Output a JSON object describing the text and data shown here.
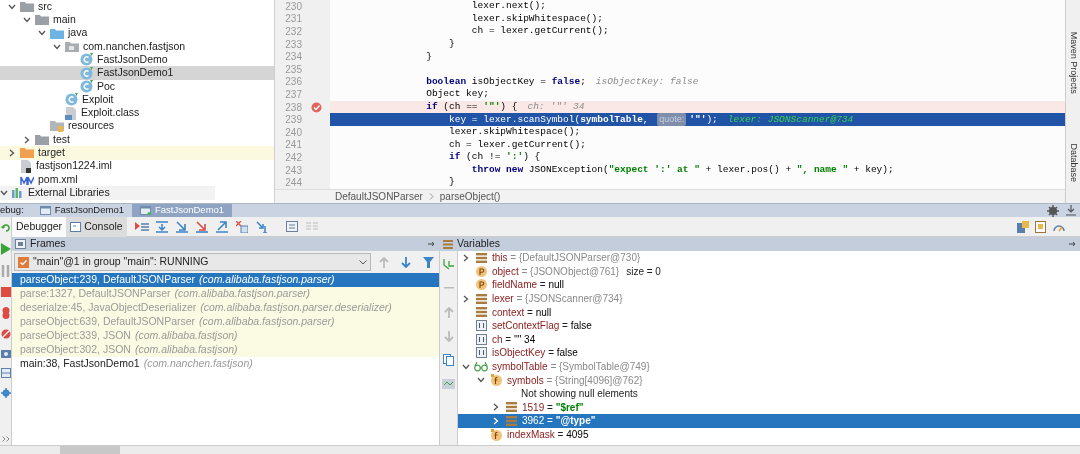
{
  "project_tree": {
    "items": [
      {
        "label": "src",
        "kind": "folder",
        "expanded": true,
        "selected": false,
        "children": [
          {
            "label": "main",
            "kind": "folder",
            "expanded": true,
            "selected": false,
            "children": [
              {
                "label": "java",
                "kind": "source_folder",
                "expanded": true,
                "selected": false,
                "children": [
                  {
                    "label": "com.nanchen.fastjson",
                    "kind": "package",
                    "expanded": true,
                    "selected": false,
                    "children": [
                      {
                        "label": "FastJsonDemo",
                        "kind": "class",
                        "selected": false
                      },
                      {
                        "label": "FastJsonDemo1",
                        "kind": "class",
                        "selected": true
                      },
                      {
                        "label": "Poc",
                        "kind": "class",
                        "selected": false
                      }
                    ]
                  },
                  {
                    "label": "Exploit",
                    "kind": "class",
                    "selected": false
                  },
                  {
                    "label": "Exploit.class",
                    "kind": "class_file",
                    "selected": false
                  }
                ]
              },
              {
                "label": "resources",
                "kind": "resources",
                "selected": false
              }
            ]
          },
          {
            "label": "test",
            "kind": "folder",
            "expanded": false,
            "selected": false
          }
        ]
      },
      {
        "label": "target",
        "kind": "excluded_folder",
        "expanded": false,
        "selected": false
      },
      {
        "label": "fastjson1224.iml",
        "kind": "module_file",
        "selected": false
      },
      {
        "label": "pom.xml",
        "kind": "maven",
        "selected": false
      }
    ],
    "external_libraries": "External Libraries"
  },
  "editor": {
    "lines": [
      {
        "number": "230",
        "current": false,
        "breakpoint": false,
        "parts": [
          {
            "kind": "code",
            "tokens": [
              {
                "t": "                        lexer.next();",
                "kind": "plain"
              }
            ]
          }
        ]
      },
      {
        "number": "231",
        "current": false,
        "breakpoint": false,
        "parts": [
          {
            "kind": "code",
            "tokens": [
              {
                "t": "                        lexer.skipWhitespace();",
                "kind": "plain"
              }
            ]
          }
        ]
      },
      {
        "number": "232",
        "current": false,
        "breakpoint": false,
        "parts": [
          {
            "kind": "code",
            "tokens": [
              {
                "t": "                        ch = lexer.getCurrent();",
                "kind": "plain"
              }
            ]
          }
        ]
      },
      {
        "number": "233",
        "current": false,
        "breakpoint": false,
        "parts": [
          {
            "kind": "code",
            "tokens": [
              {
                "t": "                    }",
                "kind": "plain"
              }
            ]
          }
        ]
      },
      {
        "number": "234",
        "current": false,
        "breakpoint": false,
        "parts": [
          {
            "kind": "code",
            "tokens": [
              {
                "t": "                }",
                "kind": "plain"
              }
            ]
          }
        ]
      },
      {
        "number": "235",
        "current": false,
        "breakpoint": false
      },
      {
        "number": "236",
        "current": false,
        "breakpoint": false,
        "parts": [
          {
            "kind": "code",
            "tokens": [
              {
                "t": "                boolean",
                "kind": "keyword"
              },
              {
                "t": " isObjectKey = ",
                "kind": "plain"
              },
              {
                "t": "false",
                "kind": "keyword"
              },
              {
                "t": ";",
                "kind": "plain"
              }
            ]
          },
          {
            "kind": "inline_value",
            "text": "isObjectKey: false"
          }
        ]
      },
      {
        "number": "237",
        "current": false,
        "breakpoint": false,
        "parts": [
          {
            "kind": "code",
            "tokens": [
              {
                "t": "                Object key;",
                "kind": "plain"
              }
            ]
          }
        ]
      },
      {
        "number": "238",
        "current": false,
        "breakpoint": true,
        "parts": [
          {
            "kind": "code",
            "tokens": [
              {
                "t": "                if",
                "kind": "keyword"
              },
              {
                "t": " (ch == ",
                "kind": "plain"
              },
              {
                "t": "'\"'",
                "kind": "string"
              },
              {
                "t": ") {",
                "kind": "plain"
              }
            ]
          },
          {
            "kind": "inline_value",
            "text": "ch: '\"' 34"
          }
        ]
      },
      {
        "number": "239",
        "current": true,
        "breakpoint": false,
        "parts": [
          {
            "kind": "code",
            "tokens": [
              {
                "t": "                    key = lexer.scanSymbol(",
                "kind": "plain"
              },
              {
                "t": "symbolTable",
                "kind": "field"
              },
              {
                "t": ", ",
                "kind": "plain"
              }
            ]
          },
          {
            "kind": "param_hint",
            "text": "quote:"
          },
          {
            "kind": "code",
            "tokens": [
              {
                "t": "'\"'",
                "kind": "string"
              },
              {
                "t": ");",
                "kind": "plain"
              }
            ]
          },
          {
            "kind": "inline_value",
            "text": "lexer: JSONScanner@734"
          }
        ]
      },
      {
        "number": "240",
        "current": false,
        "breakpoint": false,
        "parts": [
          {
            "kind": "code",
            "tokens": [
              {
                "t": "                    lexer.skipWhitespace();",
                "kind": "plain"
              }
            ]
          }
        ]
      },
      {
        "number": "241",
        "current": false,
        "breakpoint": false,
        "parts": [
          {
            "kind": "code",
            "tokens": [
              {
                "t": "                    ch = lexer.getCurrent();",
                "kind": "plain"
              }
            ]
          }
        ]
      },
      {
        "number": "242",
        "current": false,
        "breakpoint": false,
        "parts": [
          {
            "kind": "code",
            "tokens": [
              {
                "t": "                    if",
                "kind": "keyword"
              },
              {
                "t": " (ch != ",
                "kind": "plain"
              },
              {
                "t": "':'",
                "kind": "string"
              },
              {
                "t": ") {",
                "kind": "plain"
              }
            ]
          }
        ]
      },
      {
        "number": "243",
        "current": false,
        "breakpoint": false,
        "parts": [
          {
            "kind": "code",
            "tokens": [
              {
                "t": "                        throw",
                "kind": "keyword"
              },
              {
                "t": " new",
                "kind": "keyword"
              },
              {
                "t": " JSONException(",
                "kind": "plain"
              },
              {
                "t": "\"expect ':' at \"",
                "kind": "string"
              },
              {
                "t": " + lexer.pos() + ",
                "kind": "plain"
              },
              {
                "t": "\", name \"",
                "kind": "string"
              },
              {
                "t": " + key);",
                "kind": "plain"
              }
            ]
          }
        ]
      },
      {
        "number": "244",
        "current": false,
        "breakpoint": false,
        "parts": [
          {
            "kind": "code",
            "tokens": [
              {
                "t": "                    }",
                "kind": "plain"
              }
            ]
          }
        ]
      }
    ],
    "breadcrumbs": [
      "DefaultJSONParser",
      "parseObject()"
    ]
  },
  "side_tabs": [
    "Maven Projects",
    "Database"
  ],
  "debug": {
    "label": "ebug:",
    "tabs": [
      {
        "label": "FastJsonDemo1",
        "selected": false
      },
      {
        "label": "FastJsonDemo1",
        "selected": true
      }
    ],
    "subtabs": [
      {
        "label": "Debugger",
        "selected": true
      },
      {
        "label": "Console",
        "selected": false
      }
    ],
    "frames": {
      "title": "Frames",
      "thread": "\"main\"@1 in group \"main\": RUNNING",
      "rows": [
        {
          "method": "parseObject:239, DefaultJSONParser",
          "package": "(com.alibaba.fastjson.parser)",
          "library": false,
          "selected": true
        },
        {
          "method": "parse:1327, DefaultJSONParser",
          "package": "(com.alibaba.fastjson.parser)",
          "library": true,
          "selected": false
        },
        {
          "method": "deserialze:45, JavaObjectDeserializer",
          "package": "(com.alibaba.fastjson.parser.deserializer)",
          "library": true,
          "selected": false
        },
        {
          "method": "parseObject:639, DefaultJSONParser",
          "package": "(com.alibaba.fastjson.parser)",
          "library": true,
          "selected": false
        },
        {
          "method": "parseObject:339, JSON",
          "package": "(com.alibaba.fastjson)",
          "library": true,
          "selected": false
        },
        {
          "method": "parseObject:302, JSON",
          "package": "(com.alibaba.fastjson)",
          "library": true,
          "selected": false
        },
        {
          "method": "main:38, FastJsonDemo1",
          "package": "(com.nanchen.fastjson)",
          "library": false,
          "selected": false
        }
      ]
    },
    "variables": {
      "title": "Variables",
      "items": [
        {
          "kind": "object",
          "name": "this",
          "operator": "=",
          "value": "{DefaultJSONParser@730}",
          "greyed": true,
          "expanded": false,
          "selected": false
        },
        {
          "kind": "parameter",
          "name": "object",
          "operator": "=",
          "value": "{JSONObject@761}",
          "greyed": true,
          "extra": "size = 0",
          "selected": false
        },
        {
          "kind": "parameter",
          "name": "fieldName",
          "operator": "=",
          "value": "null",
          "selected": false
        },
        {
          "kind": "object",
          "name": "lexer",
          "operator": "=",
          "value": "{JSONScanner@734}",
          "greyed": true,
          "expanded": false,
          "selected": false
        },
        {
          "kind": "object",
          "name": "context",
          "operator": "=",
          "value": "null",
          "selected": false
        },
        {
          "kind": "primitive",
          "name": "setContextFlag",
          "operator": "=",
          "value": "false",
          "selected": false
        },
        {
          "kind": "primitive",
          "name": "ch",
          "operator": "=",
          "value": "'\"' 34",
          "selected": false
        },
        {
          "kind": "primitive",
          "name": "isObjectKey",
          "operator": "=",
          "value": "false",
          "selected": false
        },
        {
          "kind": "watch",
          "name": "symbolTable",
          "operator": "=",
          "value": "{SymbolTable@749}",
          "greyed": true,
          "expanded": true,
          "selected": false,
          "children": [
            {
              "kind": "field",
              "name": "symbols",
              "operator": "=",
              "value": "{String[4096]@762}",
              "greyed": true,
              "expanded": true,
              "selected": false,
              "children": [
                {
                  "kind": "info",
                  "text": "Not showing null elements"
                },
                {
                  "kind": "object",
                  "name": "1519",
                  "operator": "=",
                  "value": "\"$ref\"",
                  "string_literal": true,
                  "expanded": false,
                  "selected": false
                },
                {
                  "kind": "object",
                  "name": "3962",
                  "operator": "=",
                  "value": "\"@type\"",
                  "string_literal": true,
                  "expanded": false,
                  "selected": true
                }
              ]
            },
            {
              "kind": "field",
              "name": "indexMask",
              "operator": "=",
              "value": "4095",
              "selected": false
            }
          ]
        }
      ]
    }
  }
}
